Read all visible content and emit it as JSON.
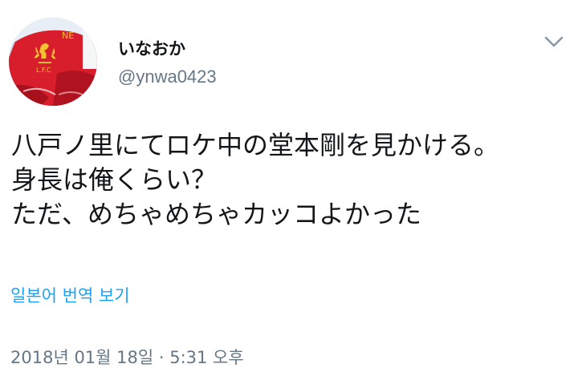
{
  "user": {
    "display_name": "いなおか",
    "username": "@ynwa0423",
    "avatar_icon": "lfc-liverbird-avatar"
  },
  "menu": {
    "icon": "chevron-down-icon"
  },
  "tweet": {
    "lines": [
      "八戸ノ里にてロケ中の堂本剛を見かける。",
      "身長は俺くらい？",
      "ただ、めちゃめちゃカッコよかった"
    ],
    "translate_label": "일본어 번역 보기",
    "timestamp": "2018년 01월 18일 · 5:31 오후"
  },
  "colors": {
    "text": "#14171a",
    "secondary": "#657786",
    "link": "#1da1f2",
    "avatar_red": "#d81e2c",
    "avatar_gold": "#f2c230"
  }
}
